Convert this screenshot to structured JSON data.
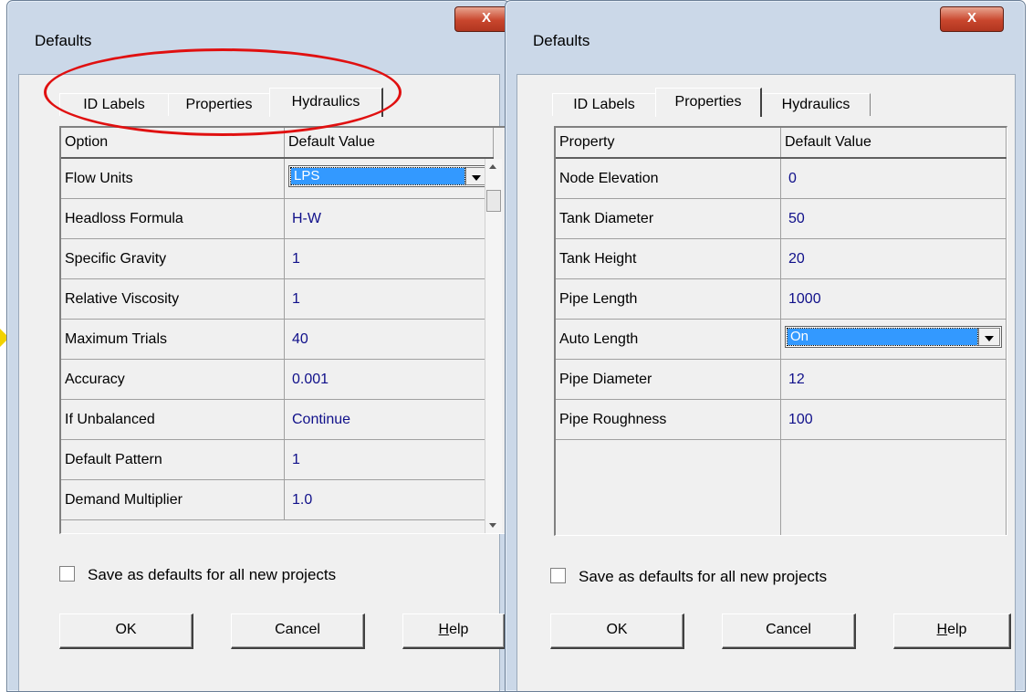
{
  "left_dialog": {
    "title": "Defaults",
    "close_label": "X",
    "tabs": [
      "ID Labels",
      "Properties",
      "Hydraulics"
    ],
    "active_tab": "Hydraulics",
    "columns": [
      "Option",
      "Default Value"
    ],
    "rows": [
      {
        "option": "Flow Units",
        "value": "LPS"
      },
      {
        "option": "Headloss Formula",
        "value": "H-W"
      },
      {
        "option": "Specific Gravity",
        "value": "1"
      },
      {
        "option": "Relative Viscosity",
        "value": "1"
      },
      {
        "option": "Maximum Trials",
        "value": "40"
      },
      {
        "option": "Accuracy",
        "value": "0.001"
      },
      {
        "option": "If Unbalanced",
        "value": "Continue"
      },
      {
        "option": "Default Pattern",
        "value": "1"
      },
      {
        "option": "Demand Multiplier",
        "value": "1.0"
      }
    ],
    "checkbox_label": "Save as defaults for all new projects",
    "checkbox_checked": false,
    "buttons": {
      "ok": "OK",
      "cancel": "Cancel",
      "help": "Help"
    }
  },
  "right_dialog": {
    "title": "Defaults",
    "close_label": "X",
    "tabs": [
      "ID Labels",
      "Properties",
      "Hydraulics"
    ],
    "active_tab": "Properties",
    "columns": [
      "Property",
      "Default Value"
    ],
    "rows": [
      {
        "option": "Node Elevation",
        "value": "0"
      },
      {
        "option": "Tank Diameter",
        "value": "50"
      },
      {
        "option": "Tank Height",
        "value": "20"
      },
      {
        "option": "Pipe Length",
        "value": "1000"
      },
      {
        "option": "Auto Length",
        "value": "On"
      },
      {
        "option": "Pipe Diameter",
        "value": "12"
      },
      {
        "option": "Pipe Roughness",
        "value": "100"
      }
    ],
    "checkbox_label": "Save as defaults for all new projects",
    "checkbox_checked": false,
    "buttons": {
      "ok": "OK",
      "cancel": "Cancel",
      "help": "Help"
    }
  },
  "colors": {
    "highlight_ellipse": "#e01010",
    "selection": "#3399ff",
    "value_text": "#10108a",
    "close_button": "#c9462d"
  }
}
